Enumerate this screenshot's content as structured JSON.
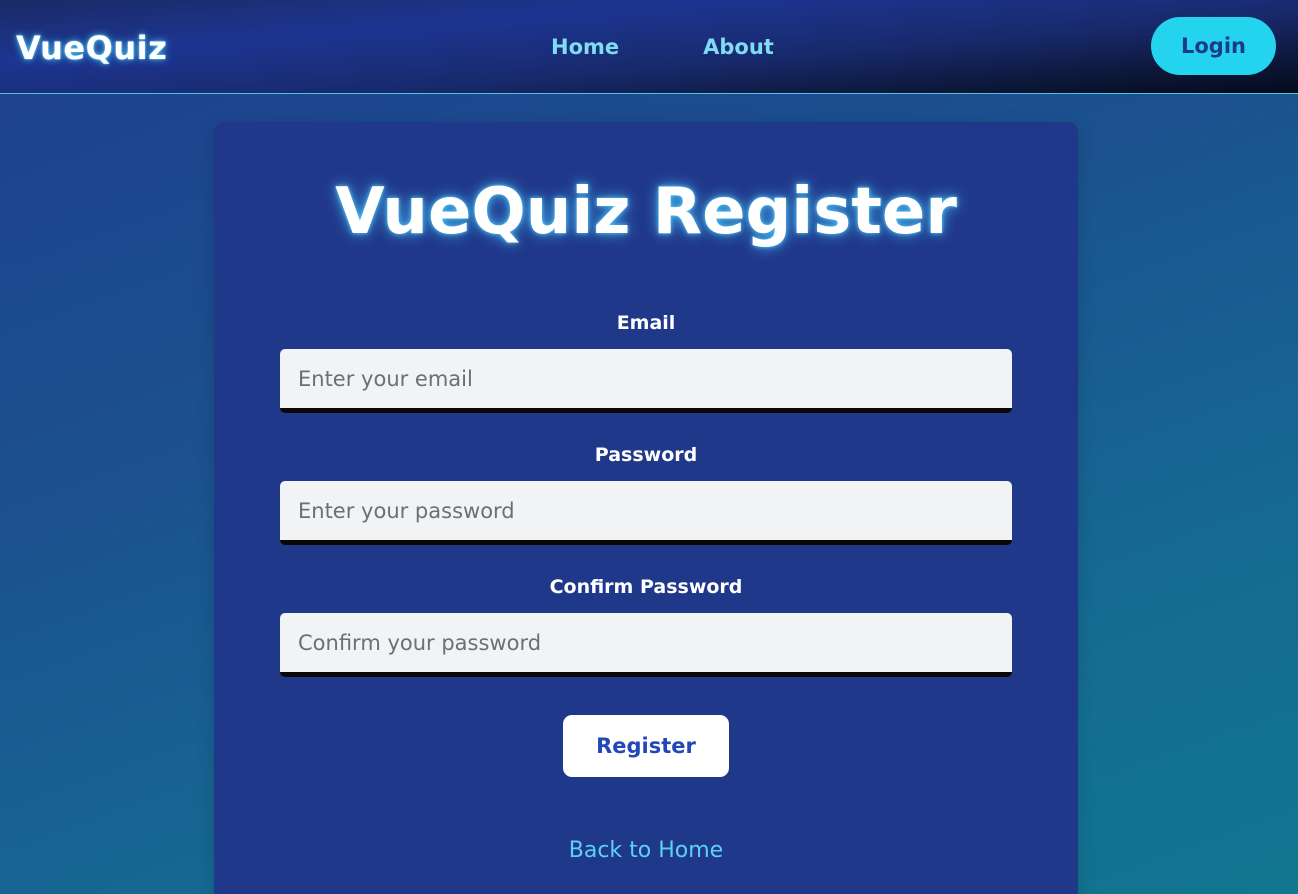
{
  "header": {
    "brand": "VueQuiz",
    "nav": [
      {
        "label": "Home"
      },
      {
        "label": "About"
      }
    ],
    "login_label": "Login"
  },
  "form": {
    "title": "VueQuiz Register",
    "email": {
      "label": "Email",
      "placeholder": "Enter your email",
      "value": ""
    },
    "password": {
      "label": "Password",
      "placeholder": "Enter your password",
      "value": ""
    },
    "confirm": {
      "label": "Confirm Password",
      "placeholder": "Confirm your password",
      "value": ""
    },
    "submit_label": "Register",
    "back_label": "Back to Home"
  },
  "colors": {
    "accent": "#24d4ef",
    "card_bg": "#20388a",
    "link": "#5ad1f5",
    "button_text": "#2447b8"
  }
}
